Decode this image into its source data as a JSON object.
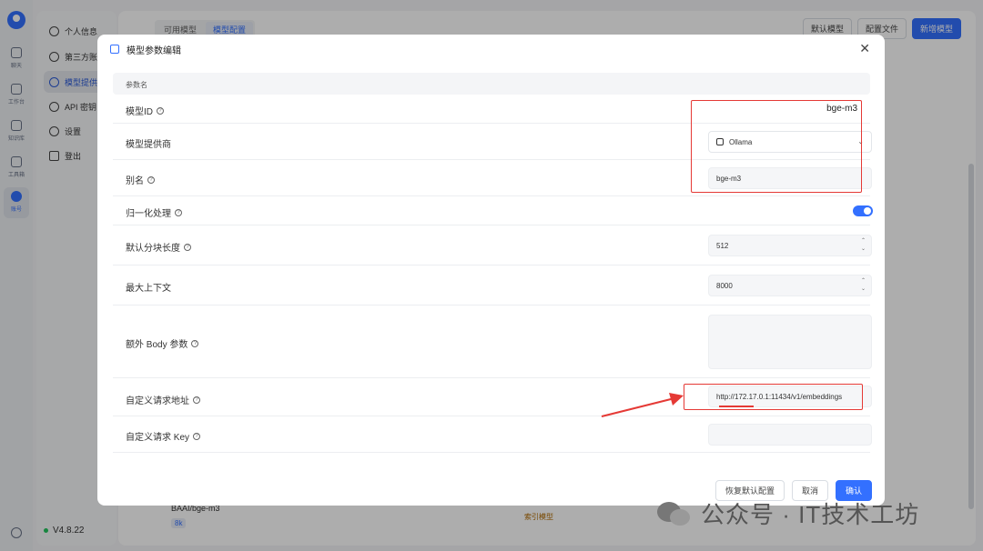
{
  "rail": {
    "items": [
      {
        "label": "聊天"
      },
      {
        "label": "工作台"
      },
      {
        "label": "知识库"
      },
      {
        "label": "工具箱"
      },
      {
        "label": "账号"
      }
    ]
  },
  "sidenav": {
    "items": [
      {
        "label": "个人信息"
      },
      {
        "label": "第三方账号"
      },
      {
        "label": "模型提供商"
      },
      {
        "label": "API 密钥"
      },
      {
        "label": "设置"
      },
      {
        "label": "登出"
      }
    ],
    "version": "V4.8.22"
  },
  "main": {
    "tabs": [
      {
        "label": "可用模型"
      },
      {
        "label": "模型配置"
      }
    ],
    "actions": {
      "default_models": "默认模型",
      "config_file": "配置文件",
      "add_model": "新增模型"
    },
    "bg_model_name": "BAAI/bge-m3",
    "bg_model_tag": "8k",
    "bg_index_label": "索引模型"
  },
  "modal": {
    "title": "模型参数编辑",
    "column_header": "参数名",
    "rows": {
      "model_id": {
        "label": "模型ID",
        "value": "bge-m3"
      },
      "provider": {
        "label": "模型提供商",
        "value": "Ollama"
      },
      "alias": {
        "label": "别名",
        "value": "bge-m3"
      },
      "normalize": {
        "label": "归一化处理",
        "enabled": true
      },
      "chunk_length": {
        "label": "默认分块长度",
        "value": "512"
      },
      "max_context": {
        "label": "最大上下文",
        "value": "8000"
      },
      "extra_body": {
        "label": "额外 Body 参数",
        "value": ""
      },
      "request_url": {
        "label": "自定义请求地址",
        "value": "http://172.17.0.1:11434/v1/embeddings"
      },
      "request_key": {
        "label": "自定义请求 Key",
        "value": ""
      }
    },
    "footer": {
      "restore": "恢复默认配置",
      "cancel": "取消",
      "confirm": "确认"
    }
  },
  "watermark": {
    "text": "公众号 · IT技术工坊"
  },
  "colors": {
    "accent": "#3370ff",
    "highlight": "#e53935"
  }
}
